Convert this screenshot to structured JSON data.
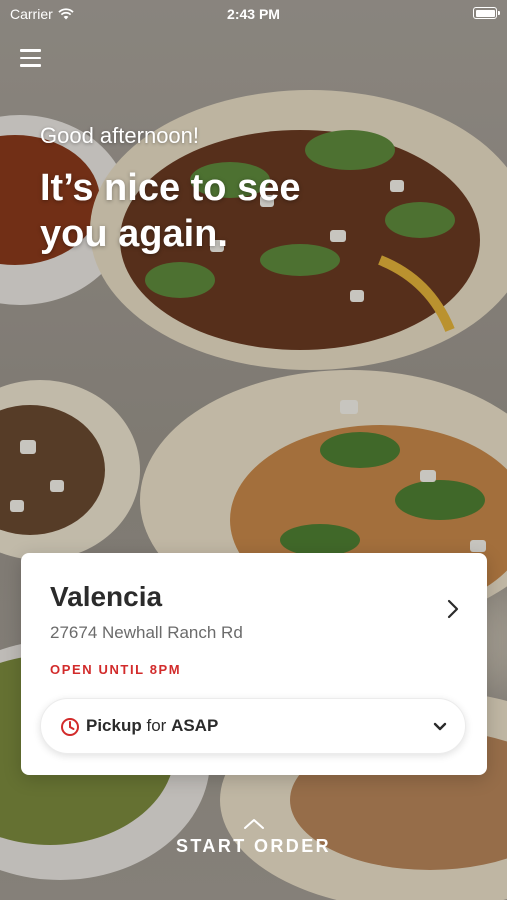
{
  "status_bar": {
    "carrier": "Carrier",
    "time": "2:43 PM"
  },
  "hero": {
    "greeting": "Good afternoon!",
    "headline": "It’s nice to see you again."
  },
  "store": {
    "name": "Valencia",
    "address": "27674 Newhall Ranch Rd",
    "hours": "OPEN UNTIL 8PM"
  },
  "order_mode": {
    "method": "Pickup",
    "connector": "for",
    "time": "ASAP"
  },
  "cta": {
    "label": "START ORDER"
  },
  "colors": {
    "accent_red": "#d22b2b",
    "card_bg": "#ffffff",
    "text_dark": "#2b2b2b"
  },
  "icons": [
    "wifi-icon",
    "battery-icon",
    "menu-icon",
    "chevron-right-icon",
    "clock-icon",
    "chevron-down-icon",
    "chevron-up-icon"
  ]
}
